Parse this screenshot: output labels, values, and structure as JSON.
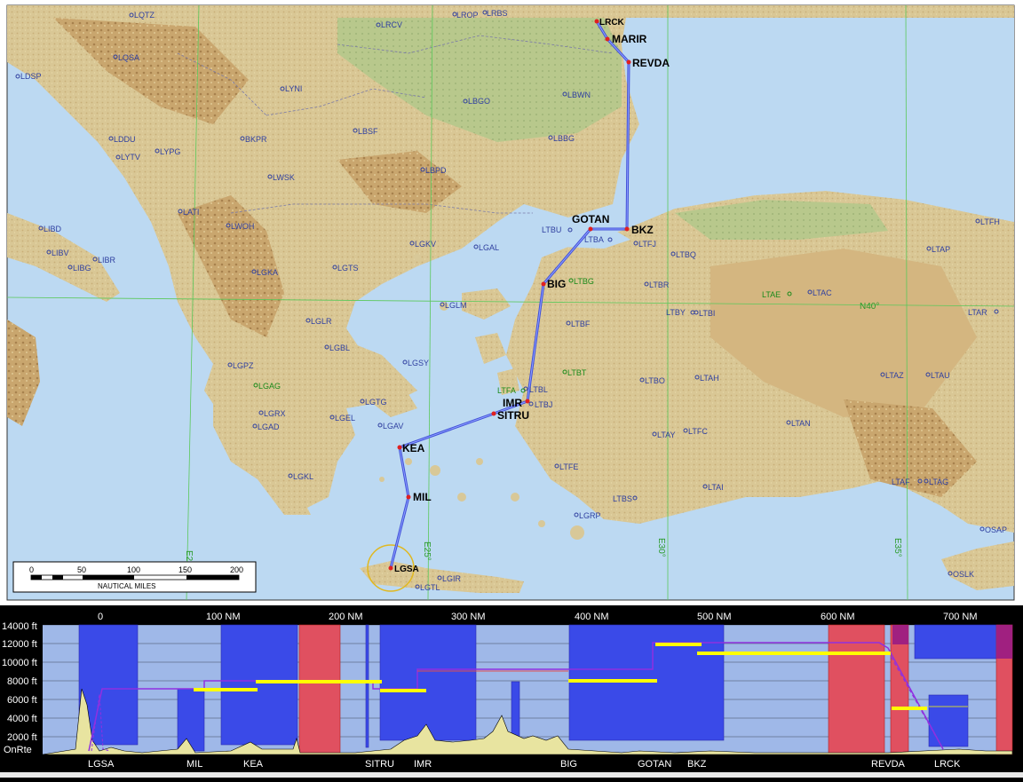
{
  "colors": {
    "sea": "#bcd9f2",
    "land": "#d8c898",
    "route": "#4050d8",
    "grid": "#5ac85a",
    "airport_blue": "#3040a0",
    "airport_green": "#1a8a1a",
    "airspace_blue": "#3a4ae8",
    "airspace_red": "#e05050",
    "profile_bg": "#9fb8e8",
    "terrain": "#e8e4a0",
    "altitude_line": "#ffff00",
    "route_profile_line": "#9030e0"
  },
  "map": {
    "waypoints": [
      "LRCK",
      "MARIR",
      "REVDA",
      "GOTAN",
      "BKZ",
      "BIG",
      "IMR",
      "SITRU",
      "KEA",
      "MIL",
      "LGSA"
    ],
    "airports_blue": [
      "LQTZ",
      "LRCV",
      "LROP",
      "LRBS",
      "LQSA",
      "LDSP",
      "LYNI",
      "LBGO",
      "LBWN",
      "LDDU",
      "LYTV",
      "LYPG",
      "BKPR",
      "LBSF",
      "LBBG",
      "LBPD",
      "LWSK",
      "LATI",
      "LWOH",
      "LIBD",
      "LIBV",
      "LIBR",
      "LIBG",
      "LGKV",
      "LGAL",
      "LTBU",
      "LTBA",
      "LTFJ",
      "LTBQ",
      "LTAP",
      "LTFH",
      "LGKA",
      "LGTS",
      "LTBR",
      "LTAC",
      "LGLM",
      "LTBY",
      "LTBI",
      "LTAR",
      "LGLR",
      "LTBF",
      "LGBL",
      "LGSY",
      "LGPZ",
      "LTBL",
      "LTBJ",
      "LTBO",
      "LTAH",
      "LTAZ",
      "LTAU",
      "LGTG",
      "LGRX",
      "LGEL",
      "LGAD",
      "LGAV",
      "LTAY",
      "LTFC",
      "LTAN",
      "LTFE",
      "LGKL",
      "LTBS",
      "LTAI",
      "LTAF",
      "LTAG",
      "LGRP",
      "LGIR",
      "LGTL",
      "OSAP",
      "OSLK"
    ],
    "airports_green": [
      "LTBG",
      "LTAE",
      "LGAG",
      "LTBT",
      "LTFA"
    ],
    "grid_labels": [
      "N40°",
      "E20°",
      "E25°",
      "E30°",
      "E35°"
    ],
    "scale": {
      "ticks": [
        "0",
        "50",
        "100",
        "150",
        "200"
      ],
      "units": "NAUTICAL MILES"
    }
  },
  "profile": {
    "distance_ticks": [
      "0",
      "100 NM",
      "200 NM",
      "300 NM",
      "400 NM",
      "500 NM",
      "600 NM",
      "700 NM"
    ],
    "altitude_ticks": [
      "14000 ft",
      "12000 ft",
      "10000 ft",
      "8000 ft",
      "6000 ft",
      "4000 ft",
      "2000 ft",
      "OnRte"
    ],
    "waypoints": [
      "LGSA",
      "MIL",
      "KEA",
      "SITRU",
      "IMR",
      "BIG",
      "GOTAN",
      "BKZ",
      "REVDA",
      "LRCK"
    ]
  }
}
